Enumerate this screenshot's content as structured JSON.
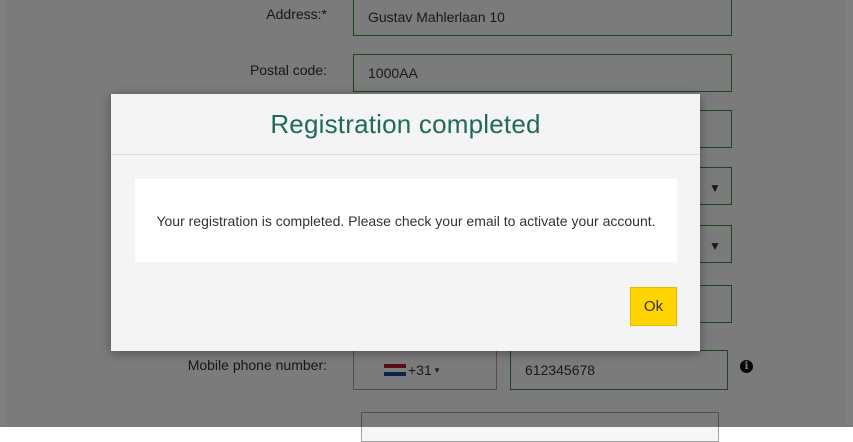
{
  "form": {
    "address_label": "Address:*",
    "address_value": "Gustav Mahlerlaan 10",
    "postal_label": "Postal code:",
    "postal_value": "1000AA",
    "mobile_label": "Mobile phone number:",
    "phone_prefix": "+31",
    "phone_value": "612345678"
  },
  "modal": {
    "title": "Registration completed",
    "message": "Your registration is completed. Please check your email to activate your account.",
    "ok_label": "Ok"
  },
  "icons": {
    "select_arrow": "▼",
    "info": "i",
    "prefix_caret": "▾"
  },
  "colors": {
    "accent_green": "#1f6b5b",
    "border_green": "#3b8a3b",
    "ok_yellow": "#ffd400"
  }
}
